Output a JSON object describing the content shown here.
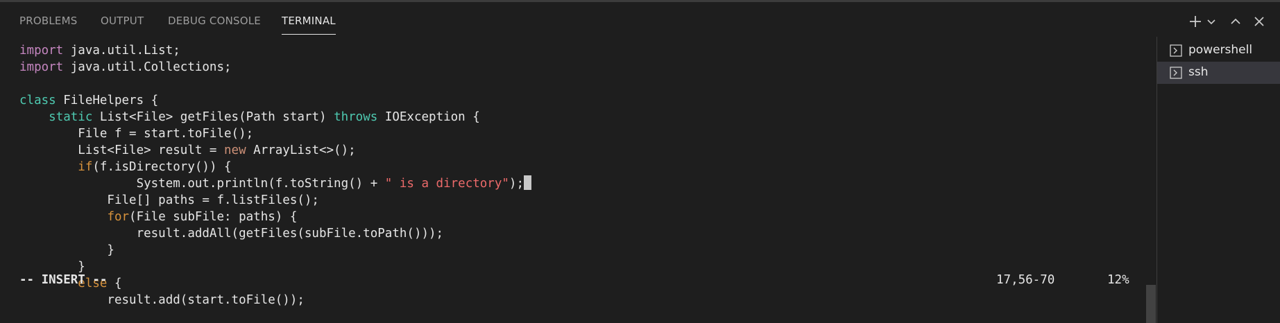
{
  "tabs": {
    "problems": "PROBLEMS",
    "output": "OUTPUT",
    "debug_console": "DEBUG CONSOLE",
    "terminal": "TERMINAL",
    "active": "TERMINAL"
  },
  "actions": {
    "new_terminal_icon": "plus-icon",
    "dropdown_icon": "chevron-down-icon",
    "maximize_icon": "chevron-up-icon",
    "close_icon": "close-icon"
  },
  "code_lines": [
    [
      {
        "t": "import",
        "c": "kw-import"
      },
      {
        "t": " java.util.List;"
      }
    ],
    [
      {
        "t": "import",
        "c": "kw-import"
      },
      {
        "t": " java.util.Collections;"
      }
    ],
    [
      {
        "t": ""
      }
    ],
    [
      {
        "t": "class",
        "c": "kw-green"
      },
      {
        "t": " FileHelpers {"
      }
    ],
    [
      {
        "t": "    "
      },
      {
        "t": "static",
        "c": "kw-green"
      },
      {
        "t": " List<File> getFiles(Path start) "
      },
      {
        "t": "throws",
        "c": "kw-green"
      },
      {
        "t": " IOException {"
      }
    ],
    [
      {
        "t": "        File f = start.toFile();"
      }
    ],
    [
      {
        "t": "        List<File> result = "
      },
      {
        "t": "new",
        "c": "kw-orange"
      },
      {
        "t": " ArrayList<>();"
      }
    ],
    [
      {
        "t": "        "
      },
      {
        "t": "if",
        "c": "kw-ctrl"
      },
      {
        "t": "(f.isDirectory()) {"
      }
    ],
    [
      {
        "t": "                System.out.println(f.toString() + "
      },
      {
        "t": "\" is a directory\"",
        "c": "str"
      },
      {
        "t": ");"
      },
      {
        "cursor": true
      }
    ],
    [
      {
        "t": "            File[] paths = f.listFiles();"
      }
    ],
    [
      {
        "t": "            "
      },
      {
        "t": "for",
        "c": "kw-ctrl"
      },
      {
        "t": "(File subFile: paths) {"
      }
    ],
    [
      {
        "t": "                result.addAll(getFiles(subFile.toPath()));"
      }
    ],
    [
      {
        "t": "            }"
      }
    ],
    [
      {
        "t": "        }"
      }
    ],
    [
      {
        "t": "        "
      },
      {
        "t": "else",
        "c": "kw-ctrl"
      },
      {
        "t": " {"
      }
    ],
    [
      {
        "t": "            result.add(start.toFile());"
      }
    ]
  ],
  "status": {
    "mode": "-- INSERT --",
    "position": "17,56-70",
    "percent": "12%"
  },
  "terminals": [
    {
      "label": "powershell",
      "icon": "terminal-icon",
      "selected": false
    },
    {
      "label": "ssh",
      "icon": "terminal-icon",
      "selected": true
    }
  ],
  "colors": {
    "background": "#1e1e1e",
    "keyword_import": "#c586c0",
    "keyword_type": "#4ec9b0",
    "keyword_control": "#d7923c",
    "string": "#ec6a6a",
    "selected_item": "#37373d"
  }
}
